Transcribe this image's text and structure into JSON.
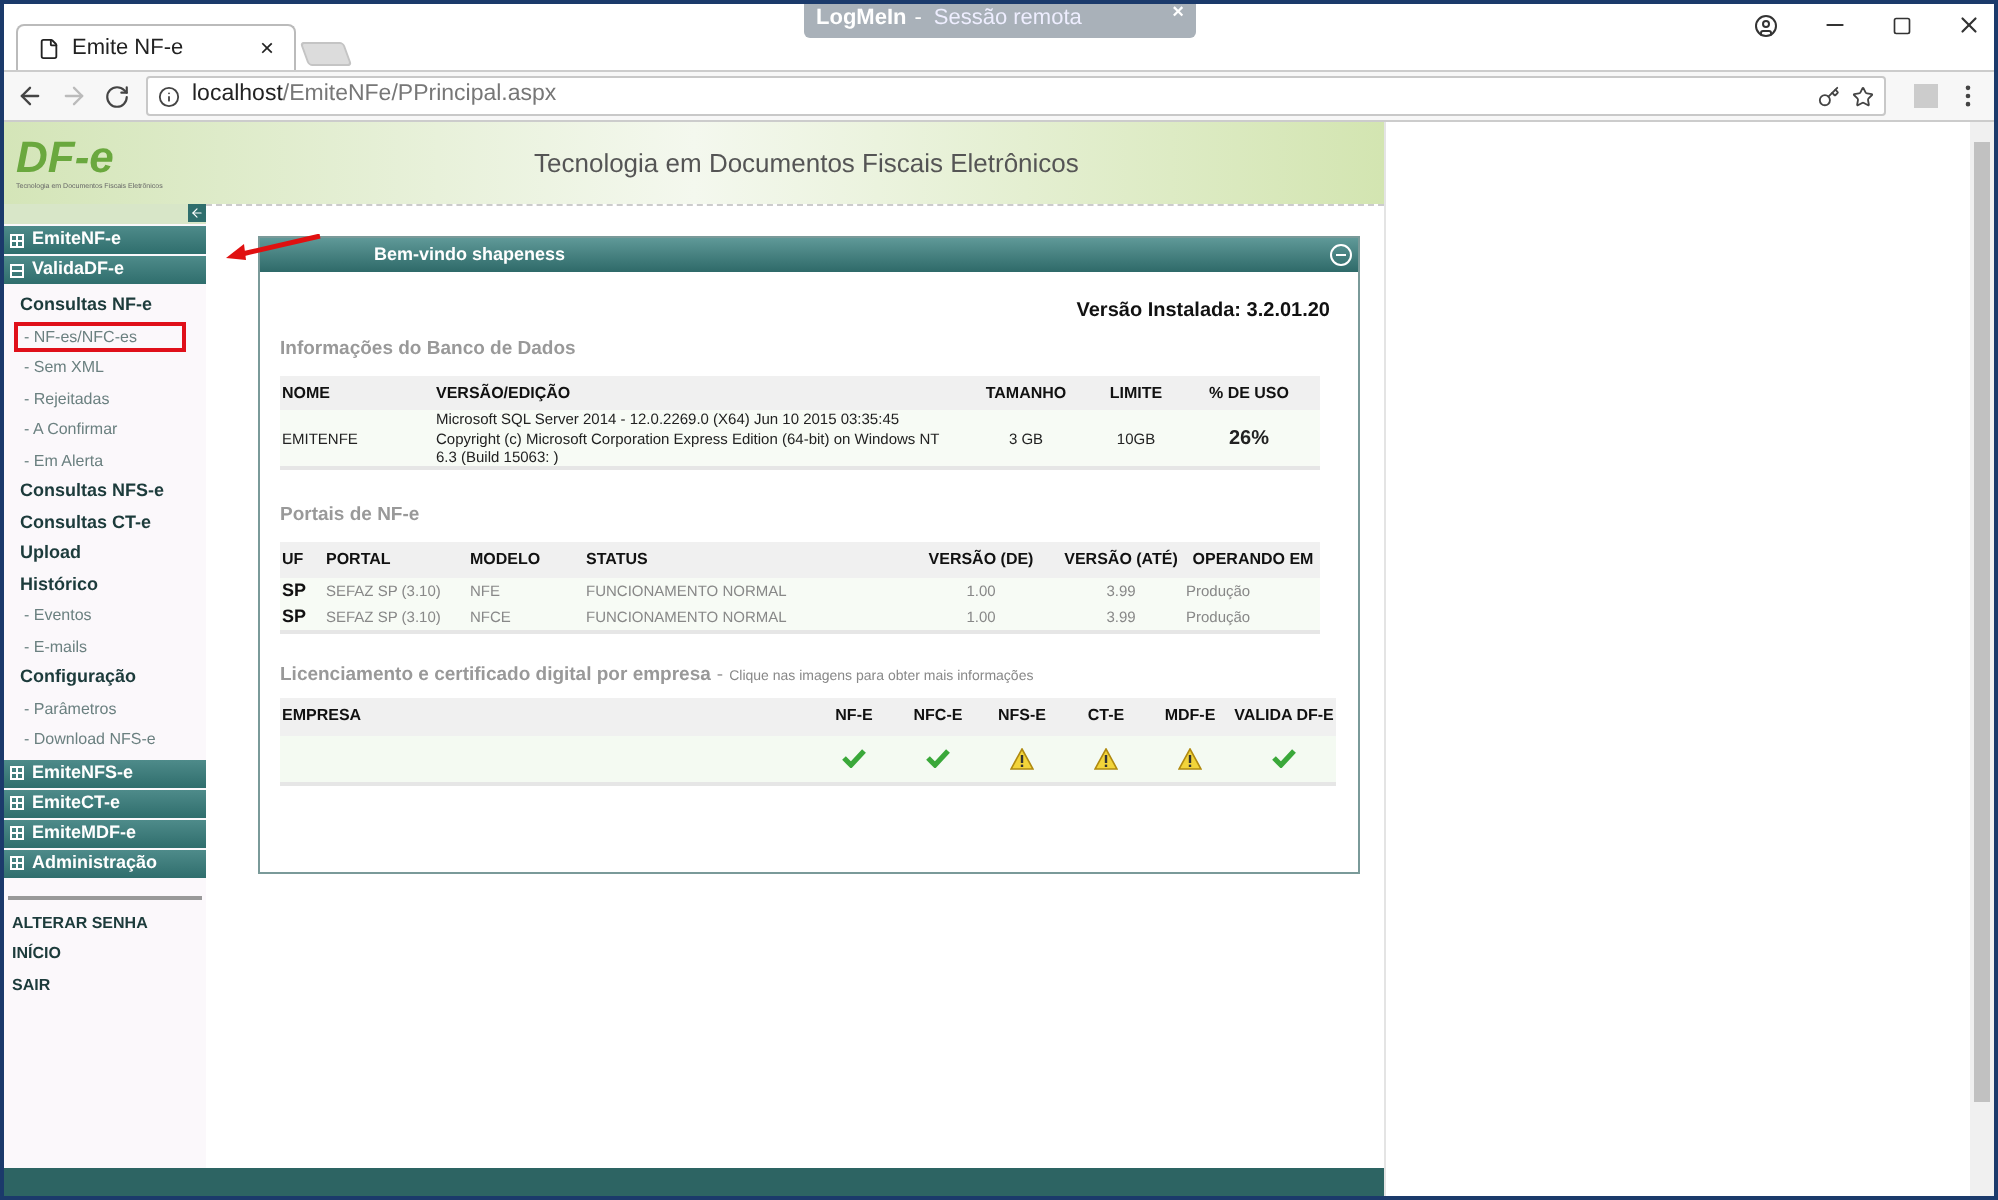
{
  "browser": {
    "tab_title": "Emite NF-e",
    "url_host": "localhost",
    "url_path": "/EmiteNFe/PPrincipal.aspx",
    "remote_banner": {
      "app": "LogMeIn",
      "separator": "-",
      "text": "Sessão remota",
      "close": "×"
    },
    "tab_close": "×"
  },
  "header": {
    "logo": "DF-e",
    "logo_subtitle": "Tecnologia em Documentos Fiscais Eletrônicos",
    "title": "Tecnologia em Documentos Fiscais Eletrônicos"
  },
  "sidebar": {
    "groups": [
      {
        "label": "EmiteNF-e",
        "expanded": false
      },
      {
        "label": "ValidaDF-e",
        "expanded": true,
        "children": [
          {
            "label": "Consultas NF-e",
            "children": [
              {
                "label": "- NF-es/NFC-es",
                "highlighted": true
              },
              {
                "label": "- Sem XML",
                "highlighted": false
              },
              {
                "label": "- Rejeitadas",
                "highlighted": false
              },
              {
                "label": "- A Confirmar",
                "highlighted": false
              },
              {
                "label": "- Em Alerta",
                "highlighted": false
              }
            ]
          },
          {
            "label": "Consultas NFS-e"
          },
          {
            "label": "Consultas CT-e"
          },
          {
            "label": "Upload"
          },
          {
            "label": "Histórico",
            "children": [
              {
                "label": "- Eventos",
                "highlighted": false
              },
              {
                "label": "- E-mails",
                "highlighted": false
              }
            ]
          },
          {
            "label": "Configuração",
            "children": [
              {
                "label": "- Parâmetros",
                "highlighted": false
              },
              {
                "label": "- Download NFS-e",
                "highlighted": false
              }
            ]
          }
        ]
      },
      {
        "label": "EmiteNFS-e",
        "expanded": false
      },
      {
        "label": "EmiteCT-e",
        "expanded": false
      },
      {
        "label": "EmiteMDF-e",
        "expanded": false
      },
      {
        "label": "Administração",
        "expanded": false
      }
    ],
    "links": [
      "ALTERAR SENHA",
      "INÍCIO",
      "SAIR"
    ]
  },
  "panel": {
    "title": "Bem-vindo shapeness",
    "version": "Versão Instalada: 3.2.01.20",
    "database": {
      "title": "Informações do Banco de Dados",
      "columns": [
        "NOME",
        "VERSÃO/EDIÇÃO",
        "TAMANHO",
        "LIMITE",
        "% DE USO"
      ],
      "rows": [
        [
          "EMITENFE",
          "Microsoft SQL Server 2014 - 12.0.2269.0 (X64) Jun 10 2015 03:35:45 Copyright (c) Microsoft Corporation Express Edition (64-bit) on Windows NT 6.3 (Build 15063: )",
          "3 GB",
          "10GB",
          "26%"
        ]
      ]
    },
    "portals": {
      "title": "Portais de NF-e",
      "columns": [
        "UF",
        "PORTAL",
        "MODELO",
        "STATUS",
        "VERSÃO (DE)",
        "VERSÃO (ATÉ)",
        "OPERANDO EM"
      ],
      "rows": [
        [
          "SP",
          "SEFAZ SP (3.10)",
          "NFE",
          "FUNCIONAMENTO NORMAL",
          "1.00",
          "3.99",
          "Produção"
        ],
        [
          "SP",
          "SEFAZ SP (3.10)",
          "NFCE",
          "FUNCIONAMENTO NORMAL",
          "1.00",
          "3.99",
          "Produção"
        ]
      ]
    },
    "licensing": {
      "title": "Licenciamento e certificado digital por empresa",
      "separator": "-",
      "hint": "Clique nas imagens para obter mais informações",
      "columns": [
        "EMPRESA",
        "NF-E",
        "NFC-E",
        "NFS-E",
        "CT-E",
        "MDF-E",
        "VALIDA DF-E"
      ],
      "rows": [
        {
          "statuses": [
            {
              "kind": "ok"
            },
            {
              "kind": "ok"
            },
            {
              "kind": "warning"
            },
            {
              "kind": "warning"
            },
            {
              "kind": "warning"
            },
            {
              "kind": "ok"
            }
          ]
        }
      ]
    }
  }
}
